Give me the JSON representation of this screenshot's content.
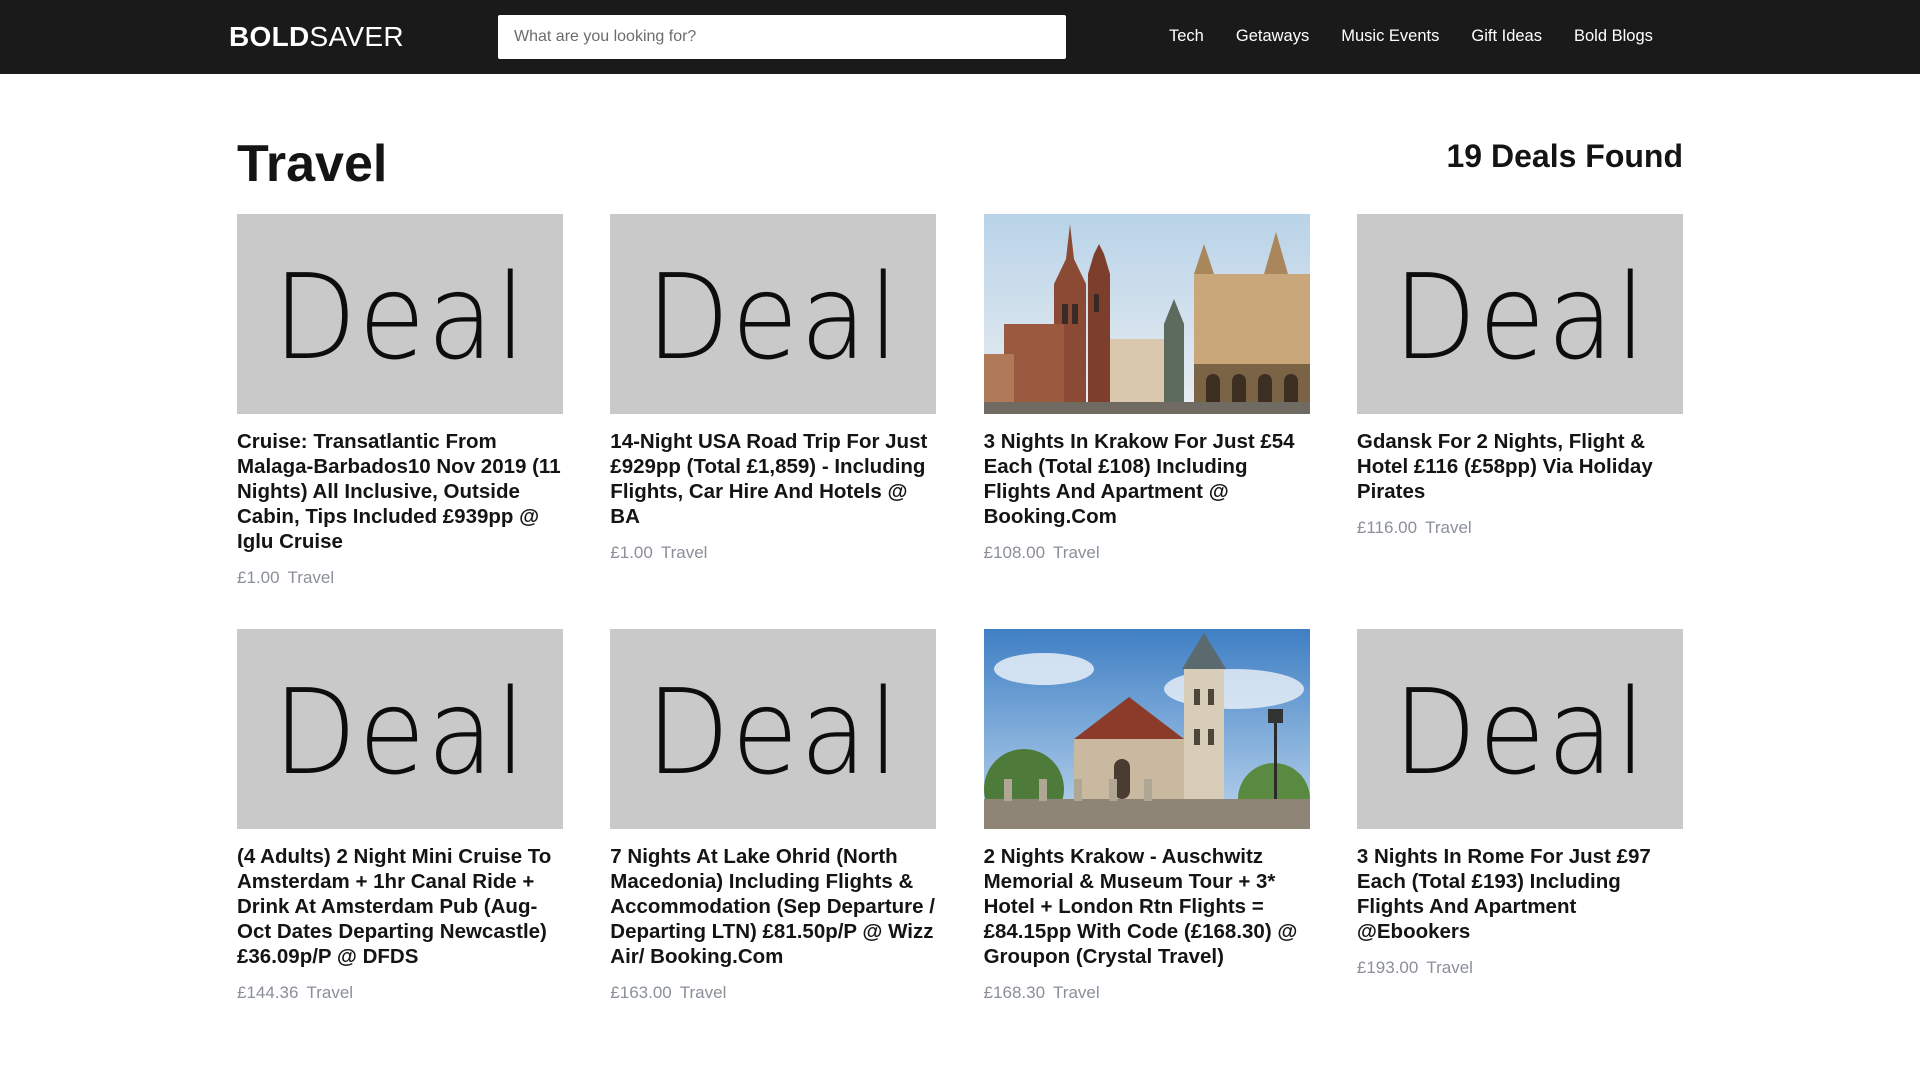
{
  "header": {
    "logo_bold": "BOLD",
    "logo_light": "SAVER",
    "search_placeholder": "What are you looking for?",
    "nav": [
      "Tech",
      "Getaways",
      "Music Events",
      "Gift Ideas",
      "Bold Blogs"
    ]
  },
  "page": {
    "title": "Travel",
    "count": "19 Deals Found"
  },
  "placeholder_text": "Deal",
  "colors": {
    "header_bg": "#1b1a1a",
    "placeholder_bg": "#c9c9c9",
    "meta_text": "#8a8f98"
  },
  "deals": [
    {
      "title": "Cruise: Transatlantic From Malaga-Barbados10 Nov 2019 (11 Nights) All Inclusive, Outside Cabin, Tips Included £939pp @ Iglu Cruise",
      "price": "£1.00",
      "category": "Travel",
      "image": "deal-placeholder"
    },
    {
      "title": "14-Night USA Road Trip For Just £929pp (Total £1,859) - Including Flights, Car Hire And Hotels @ BA",
      "price": "£1.00",
      "category": "Travel",
      "image": "deal-placeholder"
    },
    {
      "title": "3 Nights In Krakow For Just £54 Each (Total £108) Including Flights And Apartment @ Booking.Com",
      "price": "£108.00",
      "category": "Travel",
      "image": "krakow-square-photo"
    },
    {
      "title": "Gdansk For 2 Nights, Flight & Hotel £116 (£58pp) Via Holiday Pirates",
      "price": "£116.00",
      "category": "Travel",
      "image": "deal-placeholder"
    },
    {
      "title": "(4 Adults) 2 Night Mini Cruise To Amsterdam + 1hr Canal Ride + Drink At Amsterdam Pub (Aug-Oct Dates Departing Newcastle) £36.09p/P @ DFDS",
      "price": "£144.36",
      "category": "Travel",
      "image": "deal-placeholder"
    },
    {
      "title": "7 Nights At Lake Ohrid (North Macedonia) Including Flights & Accommodation (Sep Departure / Departing LTN) £81.50p/P @ Wizz Air/ Booking.Com",
      "price": "£163.00",
      "category": "Travel",
      "image": "deal-placeholder"
    },
    {
      "title": "2 Nights Krakow - Auschwitz Memorial & Museum Tour + 3* Hotel + London Rtn Flights = £84.15pp With Code (£168.30) @ Groupon (Crystal Travel)",
      "price": "£168.30",
      "category": "Travel",
      "image": "krakow-church-photo"
    },
    {
      "title": "3 Nights In Rome For Just £97 Each (Total £193) Including Flights And Apartment @Ebookers",
      "price": "£193.00",
      "category": "Travel",
      "image": "deal-placeholder"
    }
  ]
}
